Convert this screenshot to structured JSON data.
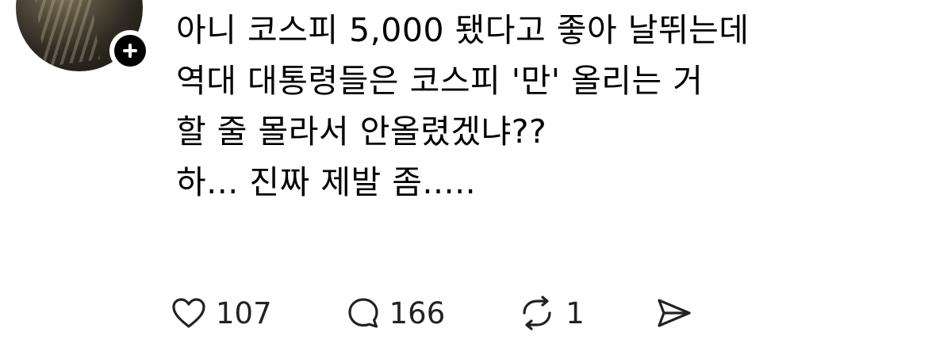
{
  "post": {
    "lines": [
      "아니 코스피 5,000 됐다고 좋아 날뛰는데",
      "역대 대통령들은 코스피 '만' 올리는 거",
      "할 줄 몰라서 안올렸겠냐??",
      "하... 진짜 제발 좀....."
    ]
  },
  "actions": {
    "like_count": "107",
    "reply_count": "166",
    "repost_count": "1"
  },
  "icons": {
    "like": "heart-icon",
    "reply": "speech-bubble-icon",
    "repost": "repost-icon",
    "share": "send-icon",
    "follow": "plus-icon"
  },
  "colors": {
    "text": "#000000",
    "icon": "#222222",
    "background": "#ffffff"
  }
}
